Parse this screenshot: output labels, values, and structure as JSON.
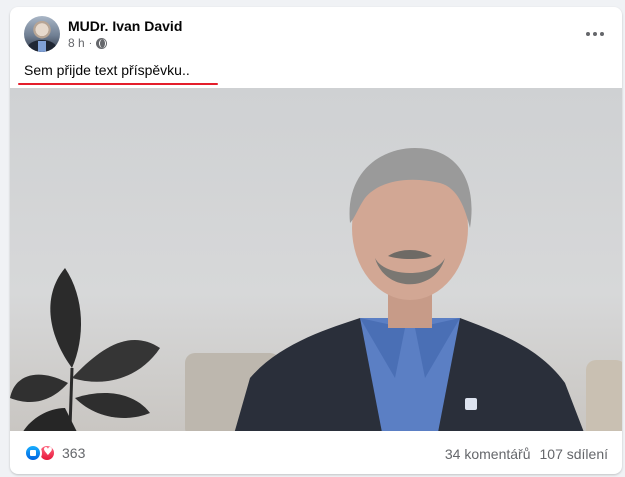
{
  "post": {
    "author": "MUDr. Ivan David",
    "time": "8 h",
    "separator": "·",
    "privacy_icon": "globe-icon",
    "text": "Sem přijde text příspěvku..",
    "media_icon": "video-thumbnail",
    "reaction_icons": [
      "like-icon",
      "love-icon"
    ],
    "reaction_count": "363",
    "comments": "34 komentářů",
    "shares": "107 sdílení"
  },
  "colors": {
    "like": "#1877f2",
    "love": "#f33e58",
    "underline": "#e41e2b",
    "muted_text": "#65676b"
  }
}
